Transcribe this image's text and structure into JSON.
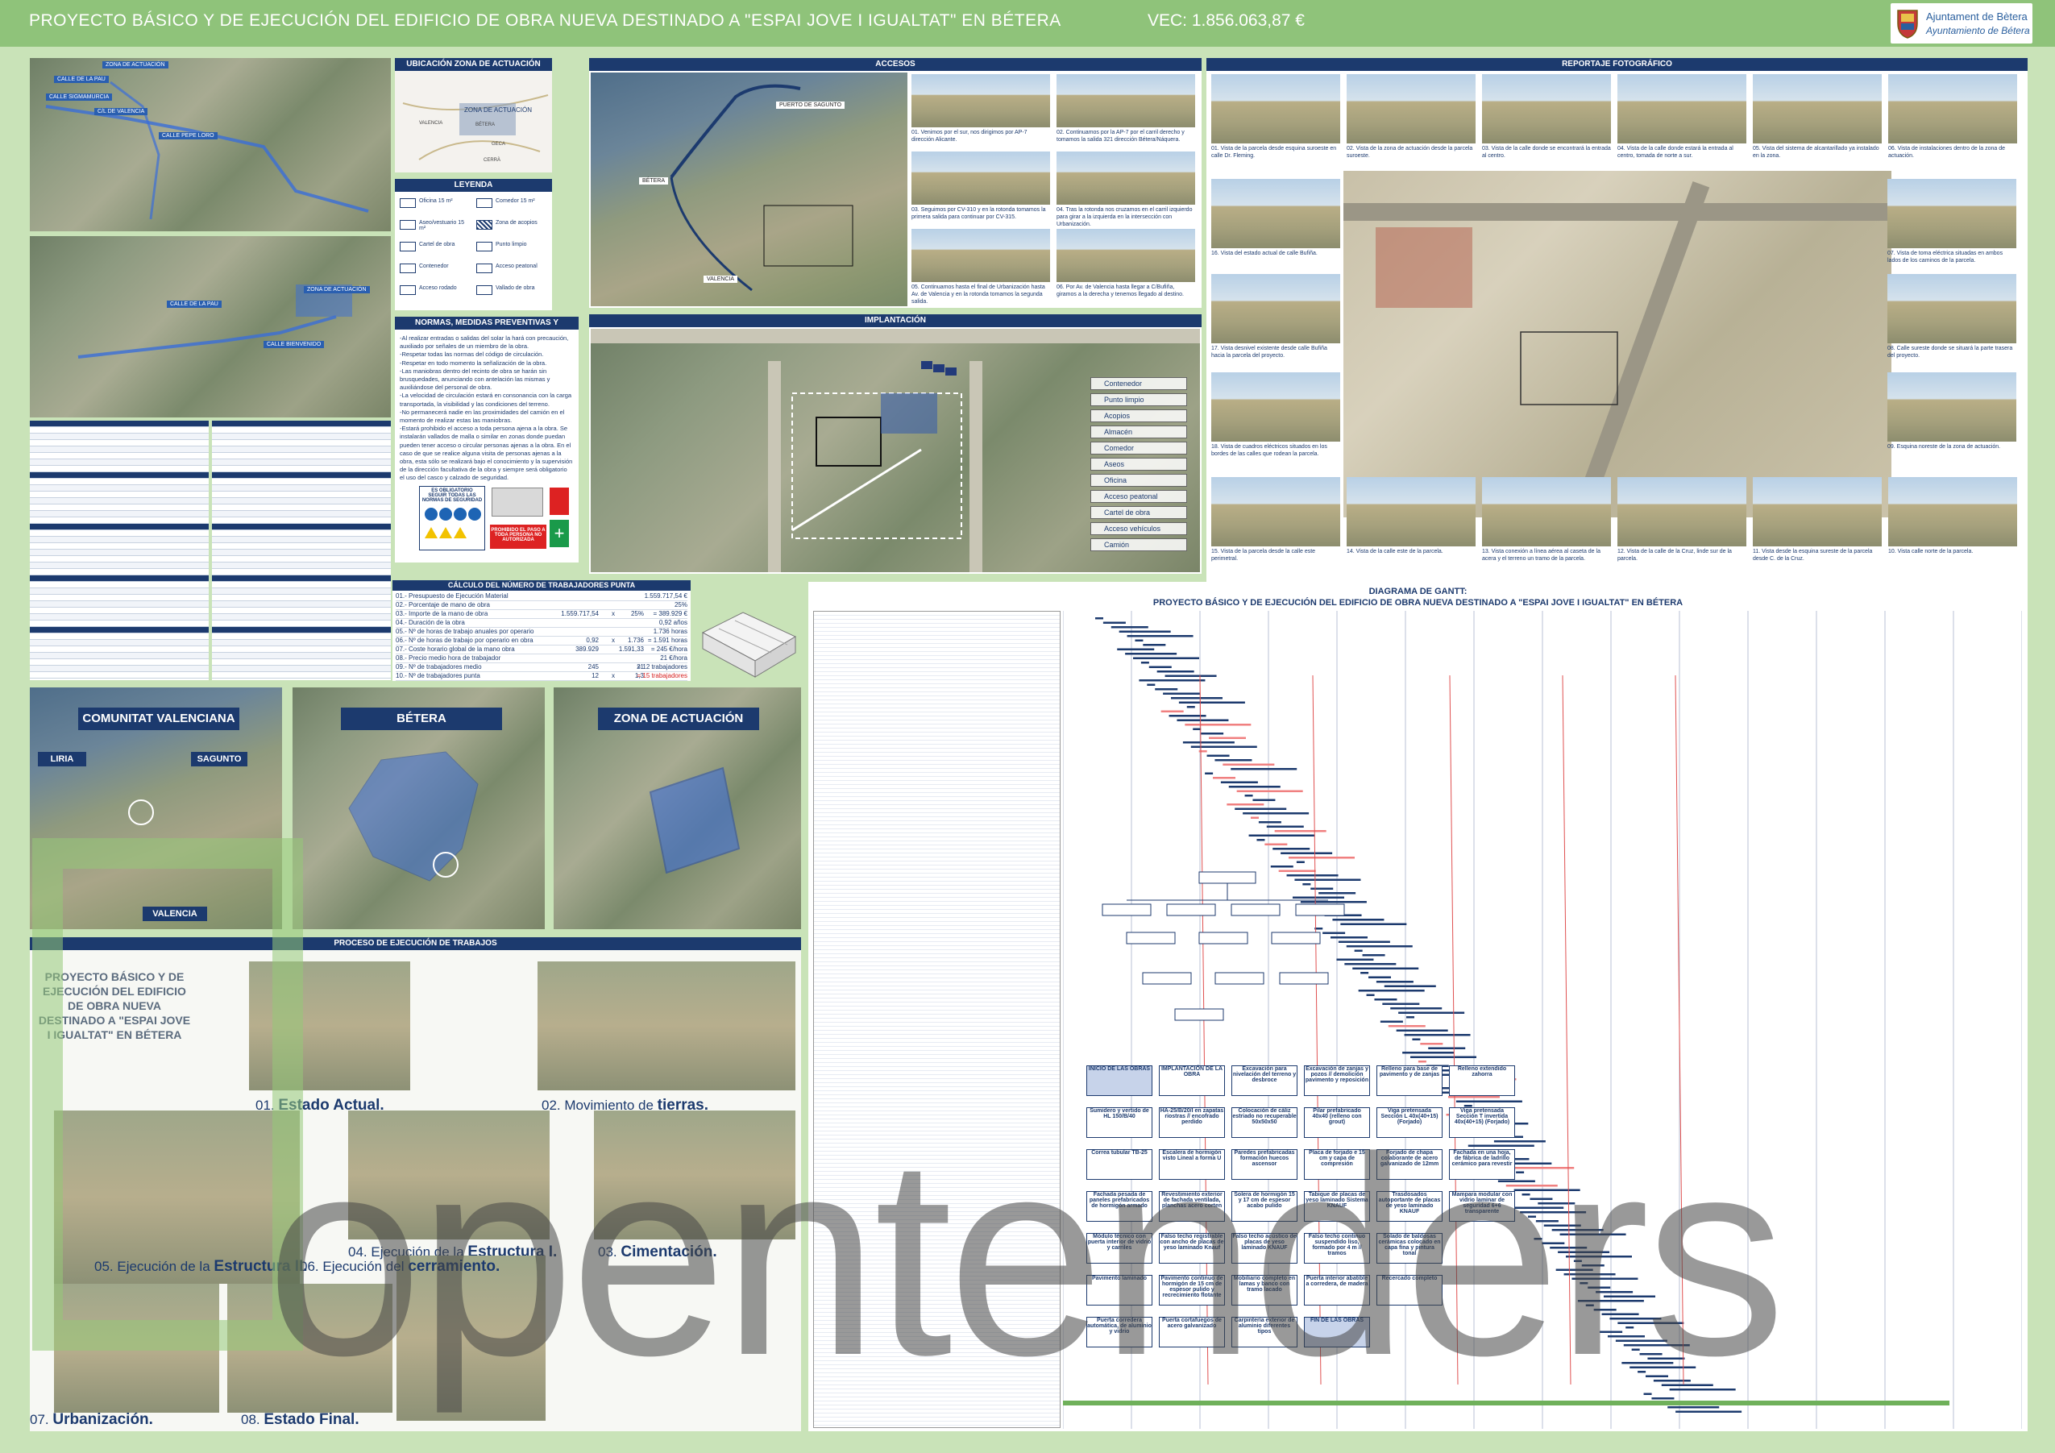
{
  "header": {
    "title": "PROYECTO BÁSICO Y DE EJECUCIÓN DEL EDIFICIO DE OBRA NUEVA DESTINADO A \"ESPAI JOVE I IGUALTAT\" EN BÉTERA",
    "vec": "VEC: 1.856.063,87  €",
    "logo_line1": "Ajuntament de Bètera",
    "logo_line2": "Ayuntamiento de Bétera"
  },
  "map_labels": [
    "ZONA DE ACTUACIÓN",
    "CALLE DE LA PAU",
    "CALLE SIGMAMURCIA",
    "C/L DE VALENCIA",
    "CALLE PEPE LORO",
    "ZONA DE ACTUACIÓN",
    "CALLE DE LA PAU",
    "CALLE BIENVENIDO"
  ],
  "ubicacion": {
    "header": "UBICACIÓN ZONA DE ACTUACIÓN",
    "zona": "ZONA DE ACTUACIÓN",
    "places": [
      "VALENCIA",
      "BÉTERA",
      "GECA",
      "CERRÀ"
    ]
  },
  "leyenda": {
    "header": "LEYENDA",
    "items": [
      "Oficina 15 m²",
      "Comedor 15 m²",
      "Aseo/vestuario 15 m²",
      "Zona de acopios",
      "Cartel de obra",
      "Punto limpio",
      "Contenedor",
      "Acceso peatonal",
      "Acceso rodado",
      "Vallado de obra"
    ]
  },
  "normas": {
    "header": "NORMAS, MEDIDAS PREVENTIVAS Y SEÑALIZACIÓN",
    "lines": [
      "-Al realizar entradas o salidas del solar la hará con precaución,",
      "auxiliado por señales de un miembro de la obra.",
      "-Respetar todas las normas del código de circulación.",
      "-Respetar en todo momento la señalización de la obra.",
      "-Las maniobras dentro del recinto de obra se harán sin",
      "brusquedades, anunciando con antelación las mismas y",
      "auxiliándose del personal de obra.",
      "-La velocidad de circulación estará en consonancia con la carga",
      "transportada, la visibilidad y las condiciones del terreno.",
      "-No permanecerá nadie en las proximidades del camión en el",
      "momento de realizar estas las maniobras.",
      "-Estará prohibido el acceso a toda persona ajena a la obra. Se",
      "instalarán vallados de malla o similar en zonas donde puedan",
      "pueden tener acceso o circular personas ajenas a la obra. En el",
      "caso de que se realice alguna visita de personas ajenas a la",
      "obra, esta sólo se realizará bajo el conocimiento y la supervisión",
      "de la dirección facultativa de la obra y siempre será obligatorio",
      "el uso del casco y calzado de seguridad."
    ],
    "sign1": "ES OBLIGATORIO SEGUIR TODAS LAS NORMAS DE SEGURIDAD",
    "sign2": "PROHIBIDO EL PASO A TODA PERSONA NO AUTORIZADA"
  },
  "accesos": {
    "header": "ACCESOS",
    "map_labels": [
      "PUERTO DE SAGUNTO",
      "BÉTERA",
      "VALENCIA"
    ],
    "captions": [
      "01. Venimos por el sur, nos dirigimos por AP-7 dirección Alicante.",
      "02. Continuamos por la AP-7 por el carril derecho y tomamos la salida 321 dirección Bétera/Náquera.",
      "03. Seguimos por CV-310 y en la rotonda tomamos la primera salida para continuar por CV-315.",
      "04. Tras la rotonda nos cruzamos en el carril izquierdo para girar a la izquierda en la intersección con Urbanización.",
      "05. Continuamos hasta el final de Urbanización hasta Av. de Valencia y en la rotonda tomamos la segunda salida.",
      "06. Por Av. de Valencia hasta llegar a C/Bufiña, giramos a la derecha y tenemos llegado al destino."
    ]
  },
  "implantacion": {
    "header": "IMPLANTACIÓN",
    "legend": [
      "Contenedor",
      "Punto limpio",
      "Acopios",
      "Almacén",
      "Comedor",
      "Aseos",
      "Oficina",
      "Acceso peatonal",
      "Cartel de obra",
      "Acceso vehículos",
      "Camión"
    ]
  },
  "reportaje": {
    "header": "REPORTAJE FOTOGRÁFICO",
    "captions": [
      "01. Vista de la parcela desde esquina suroeste en calle Dr. Fleming.",
      "02. Vista de la zona de actuación desde la parcela suroeste.",
      "03. Vista de la calle donde se encontrará la entrada al centro.",
      "04. Vista de la calle donde estará la entrada al centro, tomada de norte a sur.",
      "05. Vista del sistema de alcantarillado ya instalado en la zona.",
      "06. Vista de instalaciones dentro de la zona de actuación.",
      "16. Vista del estado actual de calle Bufiña.",
      "07. Vista de toma eléctrica situadas en ambos lados de los caminos de la parcela.",
      "17. Vista desnivel existente desde calle Bufiña hacia la parcela del proyecto.",
      "08. Calle sureste donde se situará la parte trasera del proyecto.",
      "18. Vista de cuadros eléctricos situados en los bordes de las calles que rodean la parcela.",
      "09. Esquina noreste de la zona de actuación.",
      "15. Vista de la parcela desde la calle este perimetral.",
      "14. Vista de la calle este de la parcela.",
      "13. Vista conexión a línea aérea al caseta de la acera y el terreno un tramo de la parcela.",
      "12. Vista de la calle de la Cruz, linde sur de la parcela.",
      "11. Vista desde la esquina sureste de la parcela desde C. de la Cruz.",
      "10. Vista calle norte de la parcela."
    ]
  },
  "calculo": {
    "header": "CÁLCULO DEL NÚMERO DE TRABAJADORES PUNTA",
    "rows": [
      [
        "01.- Presupuesto de Ejecución Material",
        "",
        "",
        "",
        "1.559.717,54 €"
      ],
      [
        "02.- Porcentaje de mano de obra",
        "",
        "",
        "",
        "25%"
      ],
      [
        "03.- Importe de la mano de obra",
        "1.559.717,54",
        "x",
        "25%",
        "= 389.929 €"
      ],
      [
        "04.- Duración de la obra",
        "",
        "",
        "",
        "0,92 años"
      ],
      [
        "05.- Nº de horas de trabajo anuales por operario",
        "",
        "",
        "",
        "1.736 horas"
      ],
      [
        "06.- Nº de horas de trabajo por operario en obra",
        "0,92",
        "x",
        "1.736",
        "= 1.591 horas"
      ],
      [
        "07.- Coste horario global de la mano obra",
        "389.929",
        "",
        "1.591,33",
        "= 245 €/hora"
      ],
      [
        "08.- Precio medio hora de trabajador",
        "",
        "",
        "",
        "21 €/hora"
      ],
      [
        "09.- Nº de trabajadores medio",
        "245",
        "",
        "21",
        "= 12 trabajadores"
      ],
      [
        "10.- Nº de trabajadores punta",
        "12",
        "x",
        "1,3",
        "= 15 trabajadores"
      ]
    ]
  },
  "regions": {
    "comunitat": "COMUNITAT VALENCIANA",
    "betera": "BÉTERA",
    "zona": "ZONA DE ACTUACIÓN",
    "liria": "LIRIA",
    "sagunto": "SAGUNTO",
    "valencia": "VALENCIA"
  },
  "proceso": {
    "header": "PROCESO DE EJECUCIÓN DE TRABAJOS",
    "title": "PROYECTO BÁSICO Y DE EJECUCIÓN DEL EDIFICIO DE OBRA NUEVA DESTINADO A \"ESPAI JOVE I IGUALTAT\" EN BÉTERA",
    "steps": [
      {
        "num": "01.",
        "pre": "",
        "bold": "Estado Actual."
      },
      {
        "num": "02.",
        "pre": "Movimiento de ",
        "bold": "tierras."
      },
      {
        "num": "03.",
        "pre": "",
        "bold": "Cimentación."
      },
      {
        "num": "04.",
        "pre": "Ejecución de la ",
        "bold": "Estructura I."
      },
      {
        "num": "05.",
        "pre": "Ejecución de la ",
        "bold": "Estructura II."
      },
      {
        "num": "06.",
        "pre": "Ejecución del ",
        "bold": "cerramiento."
      },
      {
        "num": "07.",
        "pre": "",
        "bold": "Urbanización."
      },
      {
        "num": "08.",
        "pre": "",
        "bold": "Estado Final."
      }
    ]
  },
  "gantt": {
    "header": "DIAGRAMA DE GANTT:",
    "subtitle": "PROYECTO BÁSICO Y DE EJECUCIÓN DEL EDIFICIO DE OBRA NUEVA DESTINADO A \"ESPAI JOVE I IGUALTAT\" EN BÉTERA"
  },
  "flow": [
    "INICIO DE LAS OBRAS",
    "IMPLANTACIÓN DE LA OBRA",
    "Excavación para nivelación del terreno y desbroce",
    "Excavación de zanjas y pozos // demolición pavimento y reposición",
    "Relleno para base de pavimento y de zanjas",
    "Relleno extendido zahorra",
    "Sumidero y vertido de HL 150/B/40",
    "HA-25/B/20/I en zapatas riostras // encofrado perdido",
    "Colocación de cáliz estriado no recuperable 50x50x50",
    "Pilar prefabricado 40x40 (relleno con grout)",
    "Viga pretensada Sección L 40x(40+15) (Forjado)",
    "Viga pretensada Sección T invertida 40x(40+15) (Forjado)",
    "Correa tubular TB-25",
    "Escalera de hormigón visto Lineal a forma U",
    "Paredes prefabricadas formación huecos ascensor",
    "Placa de forjado e 15 cm y capa de compresión",
    "Forjado de chapa colaborante de acero galvanizado de 12mm",
    "Fachada en una hoja, de fábrica de ladrillo cerámico para revestir",
    "Fachada pesada de paneles prefabricados de hormigón armado",
    "Revestimiento exterior de fachada ventilada, planchas acero corten",
    "Solera de hormigón 15 y 17 cm de espesor acabo pulido",
    "Tabique de placas de yeso laminado Sistema KNAUF",
    "Trasdosados autoportante de placas de yeso laminado KNAUF",
    "Mampara modular con vidrio laminar de seguridad 6+6 transparente",
    "Módulo técnico con puerta interior de vidrio y carriles",
    "Falso techo registrable con ancho de placas de yeso laminado Knauf",
    "Falso techo acústico de placas de yeso laminado KNAUF",
    "Falso techo continuo suspendido liso, formado por 4 m // tramos",
    "Solado de baldosas cerámicas colocado en capa fina y pintura tonal",
    "Pavimento laminado",
    "Pavimento continuo de hormigón de 15 cm de espesor pulido y recrecimiento flotante",
    "Mobiliario completo en lamas y banco con tramo lacado",
    "Puerta interior abatible a corredera, de madera",
    "Recercado completo",
    "Puerta corredera automática, de aluminio y vidrio",
    "Puerta cortafuegos de acero galvanizado",
    "Carpintería exterior de aluminio diferentes tipos",
    "FIN DE LAS OBRAS"
  ],
  "watermark": "opentenders",
  "colors": {
    "header_bg": "#8fc37a",
    "navy": "#1c3a6e",
    "page_bg": "#c9e3b8",
    "gantt_red": "#f08080"
  }
}
